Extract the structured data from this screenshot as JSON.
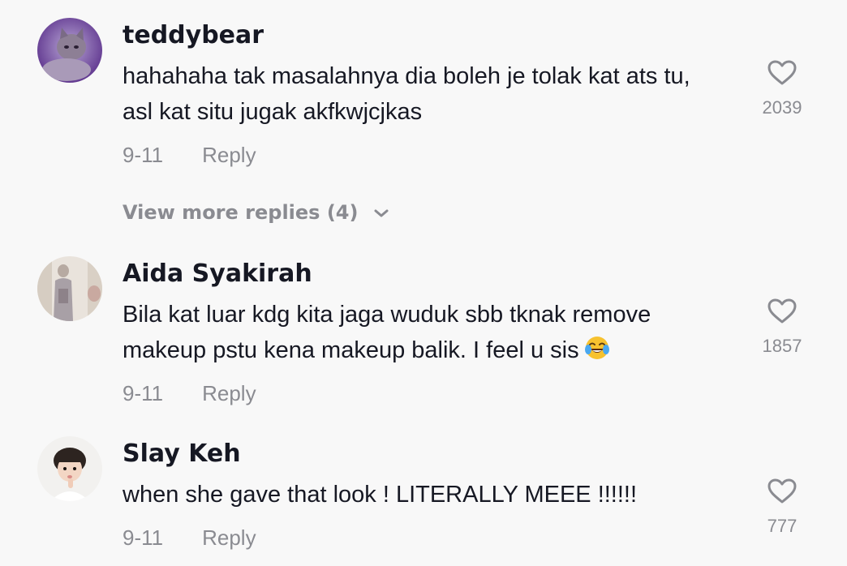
{
  "comments": [
    {
      "username": "teddybear",
      "lines": [
        "hahahaha tak masalahnya dia boleh je tolak kat ats tu,",
        "asl kat situ jugak akfkwjcjkas"
      ],
      "date": "9-11",
      "reply_label": "Reply",
      "likes": "2039",
      "avatar_icon": "cat-photo-avatar"
    },
    {
      "username": "Aida Syakirah",
      "lines": [
        "Bila kat luar kdg kita jaga wuduk sbb tknak remove",
        "makeup pstu kena makeup balik. I feel u sis"
      ],
      "emoji": "face-with-tears-of-joy",
      "date": "9-11",
      "reply_label": "Reply",
      "likes": "1857",
      "avatar_icon": "mirror-selfie-avatar"
    },
    {
      "username": "Slay Keh",
      "lines": [
        "when she gave that look ! LITERALLY MEEE !!!!!!"
      ],
      "date": "9-11",
      "reply_label": "Reply",
      "likes": "777",
      "avatar_icon": "child-photo-avatar"
    }
  ],
  "view_more": {
    "label": "View more replies (4)"
  },
  "colors": {
    "background": "#f8f8f8",
    "text": "#161823",
    "muted": "#8a8b91"
  }
}
